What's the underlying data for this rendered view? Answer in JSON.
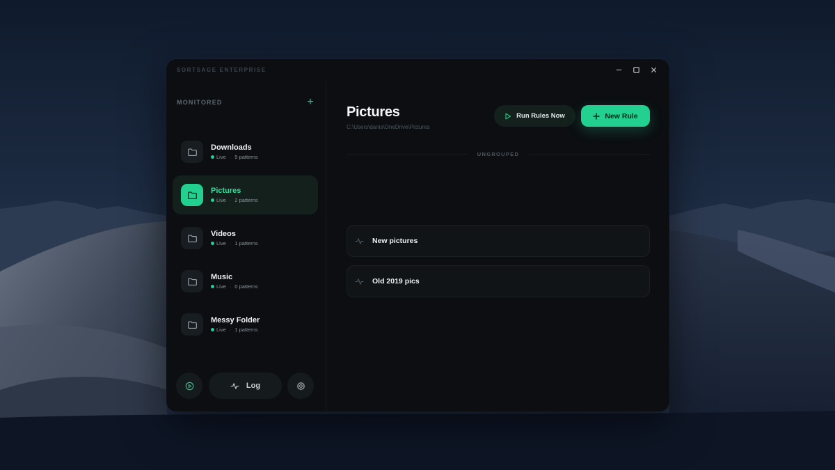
{
  "window": {
    "title": "SORTSAGE ENTERPRISE",
    "controls": {
      "minimize_icon": "minimize-icon",
      "maximize_icon": "maximize-icon",
      "close_icon": "close-icon"
    }
  },
  "sidebar": {
    "header_label": "MONITORED",
    "add_icon": "plus-icon",
    "add_glyph": "+",
    "folders": [
      {
        "name": "Downloads",
        "status": "Live",
        "patterns": "5 patterns",
        "active": false
      },
      {
        "name": "Pictures",
        "status": "Live",
        "patterns": "2 patterns",
        "active": true
      },
      {
        "name": "Videos",
        "status": "Live",
        "patterns": "1 patterns",
        "active": false
      },
      {
        "name": "Music",
        "status": "Live",
        "patterns": "0 patterns",
        "active": false
      },
      {
        "name": "Messy Folder",
        "status": "Live",
        "patterns": "1 patterns",
        "active": false
      }
    ],
    "footer": {
      "play_icon": "play-circle-icon",
      "log_label": "Log",
      "log_icon": "activity-icon",
      "settings_icon": "gear-icon"
    }
  },
  "main": {
    "title": "Pictures",
    "path": "C:\\Users\\danis\\OneDrive\\Pictures",
    "run_button_label": "Run Rules Now",
    "new_rule_button_label": "New Rule",
    "group_label": "UNGROUPED",
    "rules": [
      {
        "name": "New pictures",
        "icon": "activity-icon"
      },
      {
        "name": "Old 2019 pics",
        "icon": "activity-icon"
      }
    ]
  },
  "colors": {
    "accent": "#22d08f",
    "window_bg": "#0c0e11",
    "active_item_bg": "#14201b"
  }
}
